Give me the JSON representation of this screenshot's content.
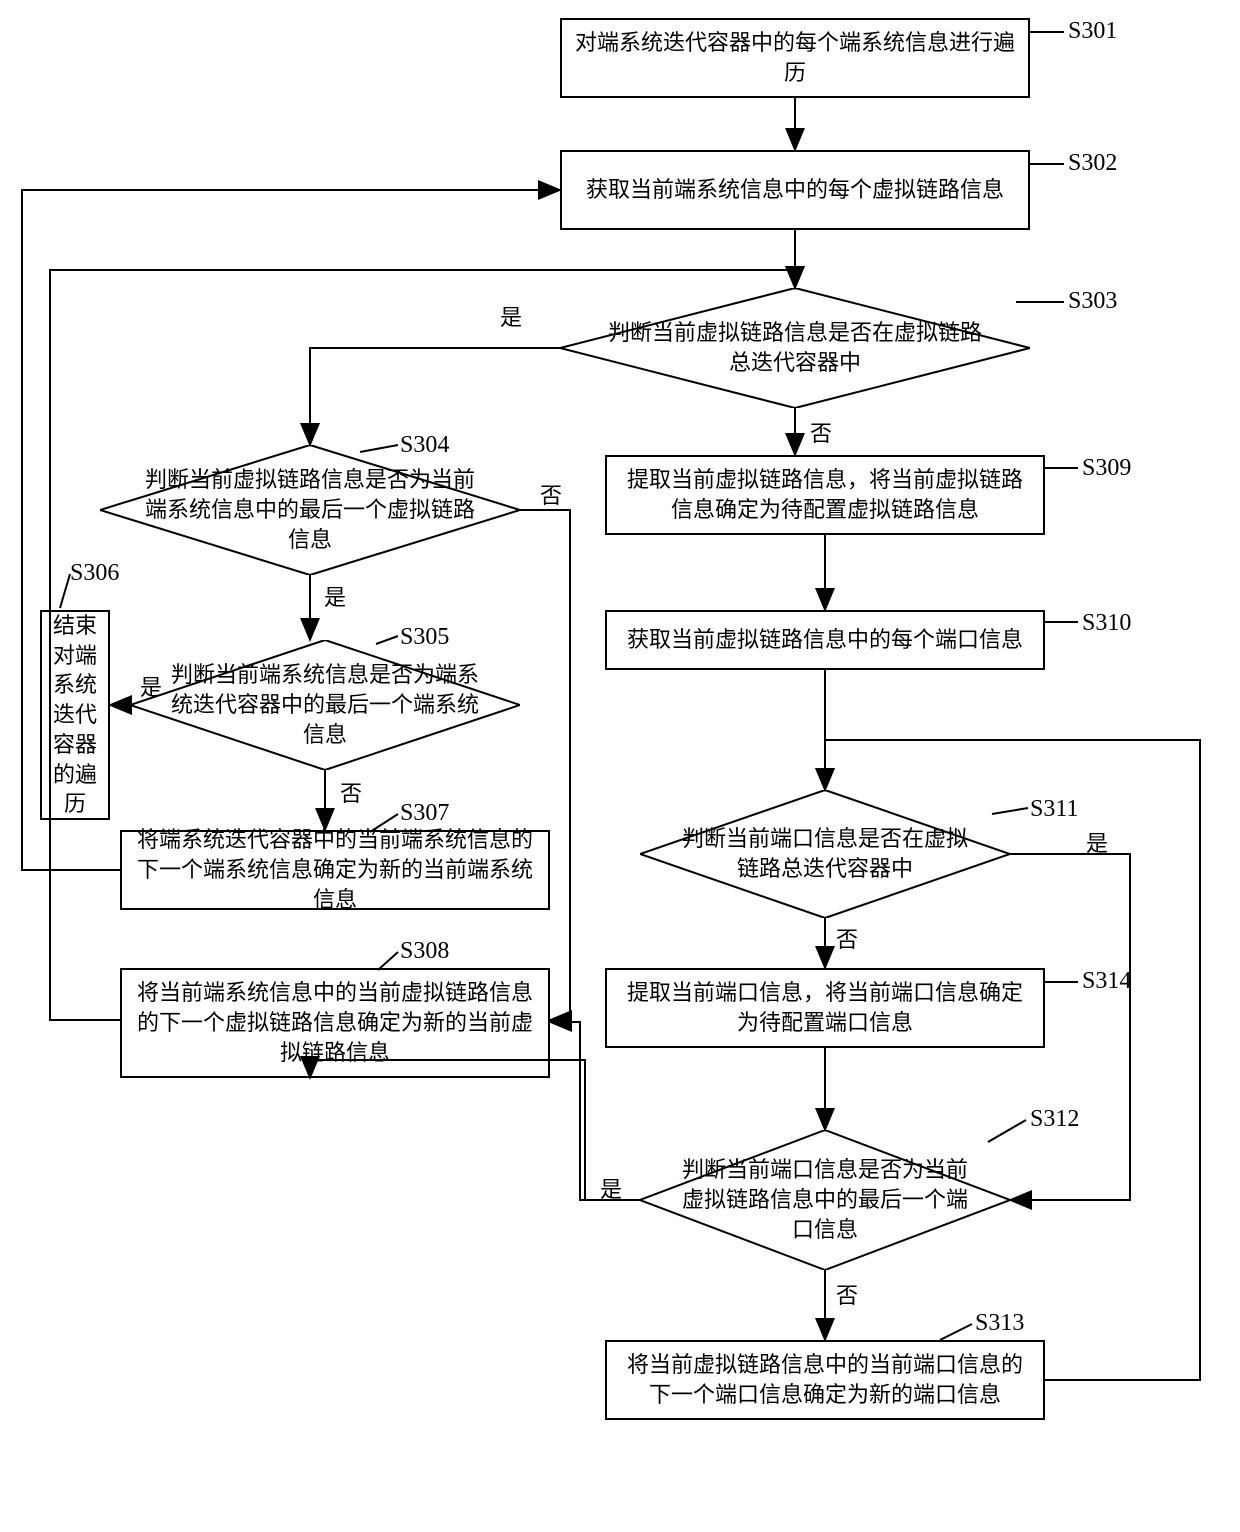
{
  "steps": {
    "s301": {
      "label": "S301",
      "text": "对端系统迭代容器中的每个端系统信息进行遍历"
    },
    "s302": {
      "label": "S302",
      "text": "获取当前端系统信息中的每个虚拟链路信息"
    },
    "s303": {
      "label": "S303",
      "text": "判断当前虚拟链路信息是否在虚拟链路总迭代容器中"
    },
    "s304": {
      "label": "S304",
      "text": "判断当前虚拟链路信息是否为当前端系统信息中的最后一个虚拟链路信息"
    },
    "s305": {
      "label": "S305",
      "text": "判断当前端系统信息是否为端系统迭代容器中的最后一个端系统信息"
    },
    "s306": {
      "label": "S306",
      "text": "结束对端系统迭代容器的遍历"
    },
    "s307": {
      "label": "S307",
      "text": "将端系统迭代容器中的当前端系统信息的下一个端系统信息确定为新的当前端系统信息"
    },
    "s308": {
      "label": "S308",
      "text": "将当前端系统信息中的当前虚拟链路信息的下一个虚拟链路信息确定为新的当前虚拟链路信息"
    },
    "s309": {
      "label": "S309",
      "text": "提取当前虚拟链路信息，将当前虚拟链路信息确定为待配置虚拟链路信息"
    },
    "s310": {
      "label": "S310",
      "text": "获取当前虚拟链路信息中的每个端口信息"
    },
    "s311": {
      "label": "S311",
      "text": "判断当前端口信息是否在虚拟链路总迭代容器中"
    },
    "s312": {
      "label": "S312",
      "text": "判断当前端口信息是否为当前虚拟链路信息中的最后一个端口信息"
    },
    "s313": {
      "label": "S313",
      "text": "将当前虚拟链路信息中的当前端口信息的下一个端口信息确定为新的端口信息"
    },
    "s314": {
      "label": "S314",
      "text": "提取当前端口信息，将当前端口信息确定为待配置端口信息"
    }
  },
  "edges": {
    "yes": "是",
    "no": "否"
  }
}
